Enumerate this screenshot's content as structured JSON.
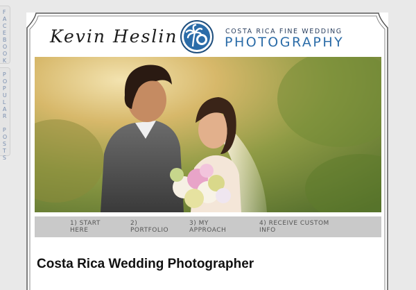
{
  "side_tabs": {
    "facebook": "FACEBOOK",
    "popular_posts": [
      "POPULAR",
      "POSTS"
    ]
  },
  "header": {
    "brand_name": "Kevin Heslin",
    "subtitle_line1": "COSTA RICA FINE WEDDING",
    "subtitle_line2": "PHOTOGRAPHY",
    "logo_icon": "palm-tree-camera-icon",
    "accent_color": "#2b6ca8"
  },
  "hero": {
    "image_description_icon": "couple-photo"
  },
  "nav": {
    "items": [
      {
        "label": "1) START\nHERE"
      },
      {
        "label": "2)\nPORTFOLIO"
      },
      {
        "label": "3) MY\nAPPROACH"
      },
      {
        "label": "4) RECEIVE CUSTOM\nINFO"
      }
    ]
  },
  "main": {
    "title": "Costa Rica Wedding Photographer"
  }
}
